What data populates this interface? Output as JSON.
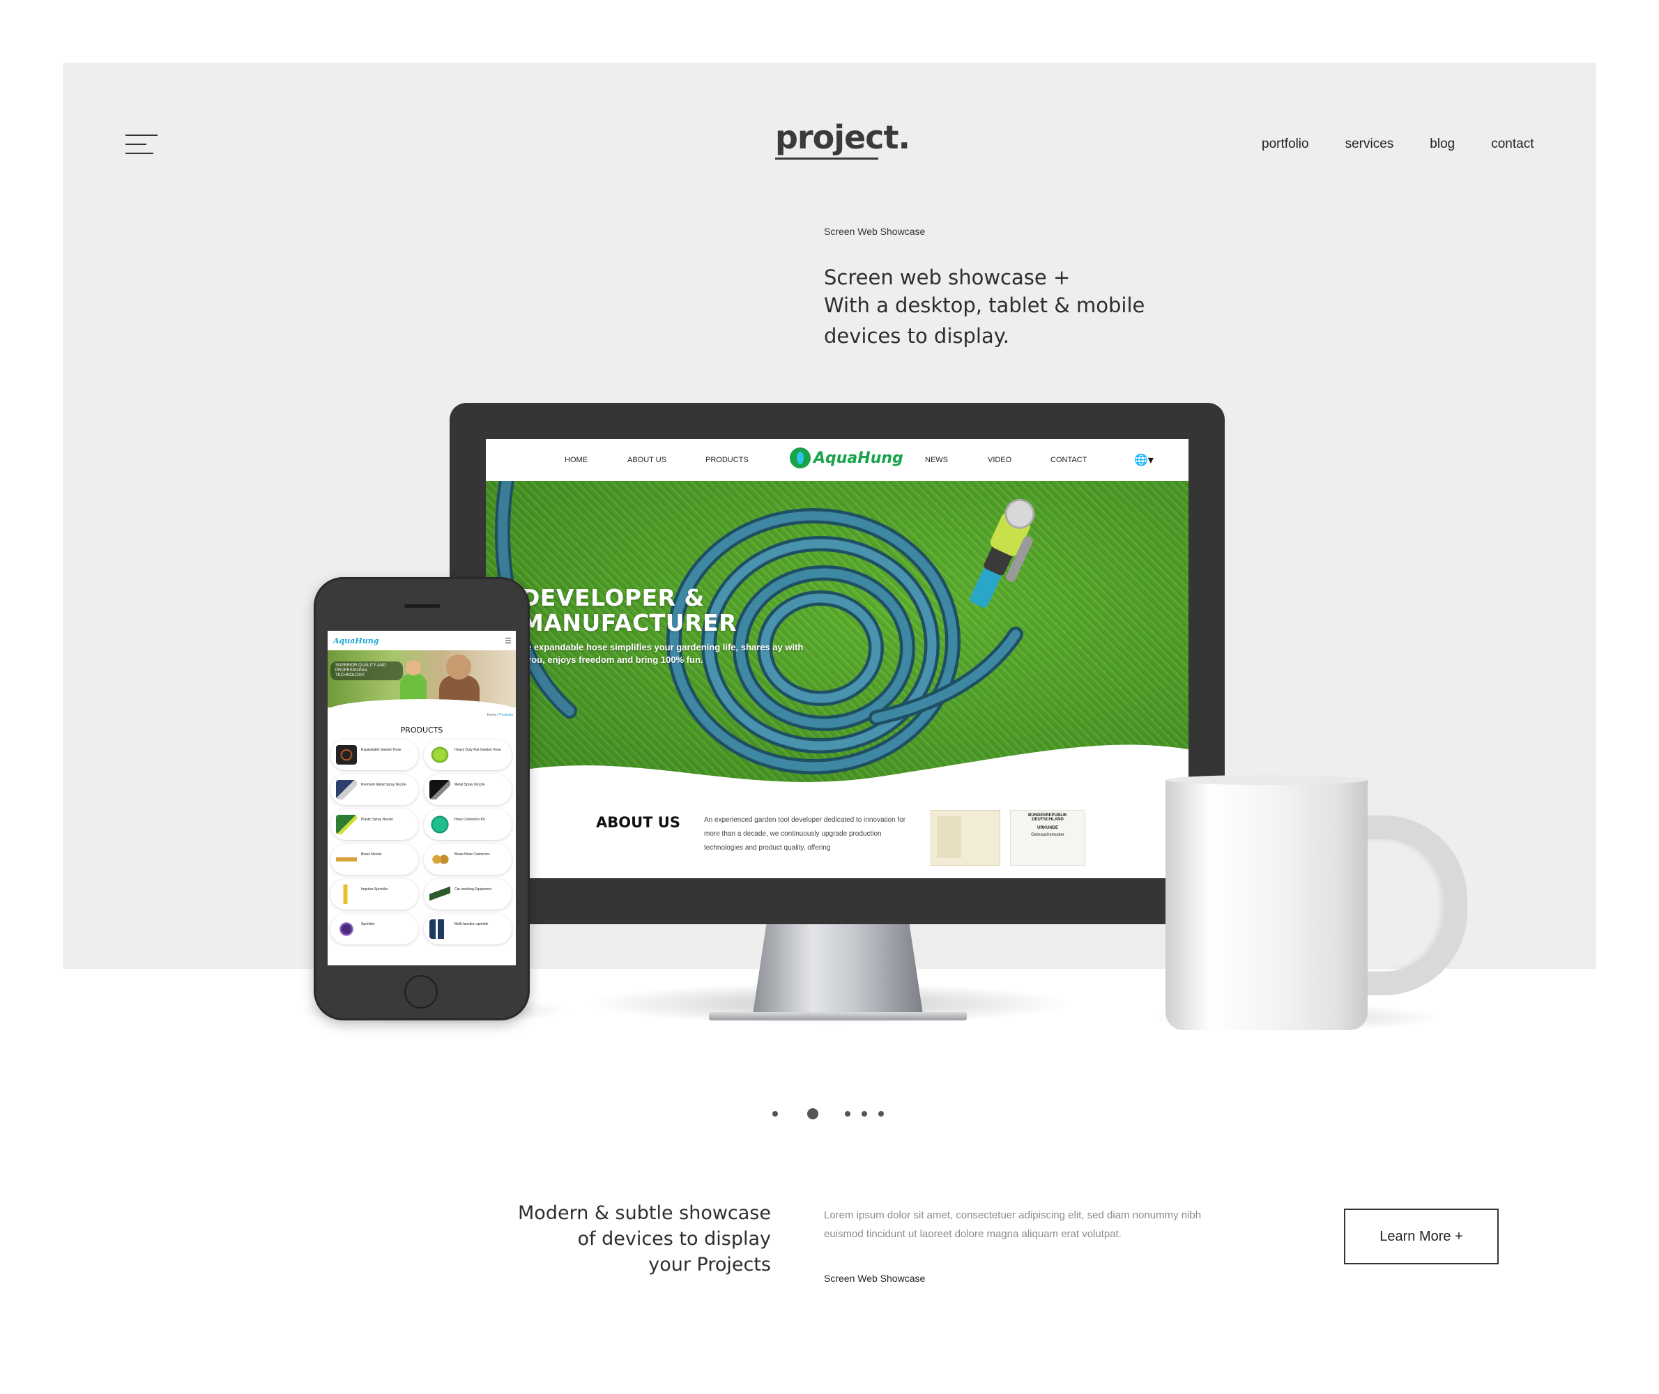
{
  "header": {
    "logo": "project.",
    "nav": [
      "portfolio",
      "services",
      "blog",
      "contact"
    ]
  },
  "hero": {
    "eyebrow": "Screen Web Showcase",
    "heading_lines": [
      "Screen web showcase +",
      "With a desktop, tablet & mobile",
      "devices to display."
    ]
  },
  "desktop_site": {
    "nav": {
      "home": "HOME",
      "about": "ABOUT US",
      "products": "PRODUCTS",
      "news": "NEWS",
      "video": "VIDEO",
      "contact": "CONTACT"
    },
    "logo": "AquaHung",
    "hero_title_lines": [
      "DEVELOPER &",
      "MANUFACTURER"
    ],
    "hero_subtitle": "e expandable hose simplifies your gardening life, shares ay with you, enjoys freedom and bring 100% fun.",
    "about_title": "ABOUT US",
    "about_text": "An experienced garden tool developer dedicated to innovation for more than a decade, we continuously upgrade production technologies and product quality, offering",
    "about_doc2_lines": [
      "BUNDESREPUBLIK DEUTSCHLAND",
      "URKUNDE",
      "Gebrauchsmuster"
    ]
  },
  "mobile_site": {
    "logo": "AquaHung",
    "banner_text": "SUPERIOR QUALITY AND PROFESSIONAL TECHNOLOGY",
    "breadcrumb_home": "Home",
    "breadcrumb_current": "Products",
    "products_title": "PRODUCTS",
    "products": [
      "Expandable Garden Hose",
      "Heavy Duty Flat Garden Hose",
      "Premium Metal Spray Nozzle",
      "Metal Spray Nozzle",
      "Plastic Spray Nozzle",
      "Hose Connector Kit",
      "Brass Nozzle",
      "Brass Hose Connector",
      "Impulse Sprinkler",
      "Car washing Equipment",
      "Sprinkler",
      "Multi-function sprinkle"
    ]
  },
  "slider": {
    "total": 5,
    "active": 2
  },
  "bottom": {
    "heading_lines": [
      "Modern & subtle showcase",
      "of devices to display",
      "your Projects"
    ],
    "body": "Lorem ipsum dolor sit amet, consectetuer adipiscing elit, sed diam nonummy nibh euismod tincidunt ut laoreet dolore magna aliquam erat volutpat.",
    "eyebrow": "Screen Web Showcase",
    "button": "Learn More +"
  },
  "colors": {
    "hero_background": "#eeeeee",
    "text_dark": "#2e2e2e",
    "device_dark": "#353535",
    "brand_green": "#16a34a",
    "brand_blue": "#1fa6d9",
    "grass_green": "#58a92f"
  },
  "icons": [
    "hamburger-menu-icon",
    "globe-icon",
    "mobile-menu-icon",
    "home-button-icon"
  ]
}
